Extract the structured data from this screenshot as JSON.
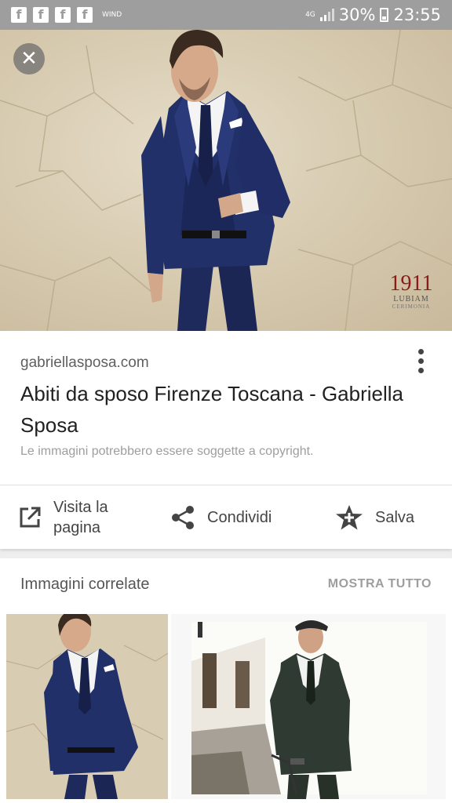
{
  "status_bar": {
    "carrier": "WIND",
    "network": "4G",
    "battery": "30%",
    "time": "23:55",
    "notification_icons": [
      "facebook-icon",
      "facebook-icon",
      "facebook-icon",
      "facebook-icon"
    ]
  },
  "hero": {
    "close_label": "✕",
    "logo_number": "1911",
    "logo_brand": "LUBIAM",
    "logo_sub": "CERIMONIA"
  },
  "result": {
    "domain": "gabriellasposa.com",
    "title": "Abiti da sposo Firenze Toscana - Gabriella Sposa",
    "copyright_note": "Le immagini potrebbero essere soggette a copyright."
  },
  "actions": {
    "visit_label": "Visita la pagina",
    "share_label": "Condividi",
    "save_label": "Salva"
  },
  "related": {
    "title": "Immagini correlate",
    "show_all": "MOSTRA TUTTO"
  },
  "colors": {
    "status_bar": "#9e9e9e",
    "suit_navy": "#1f2a5c",
    "text_primary": "#212121",
    "text_secondary": "#9e9e9e"
  }
}
